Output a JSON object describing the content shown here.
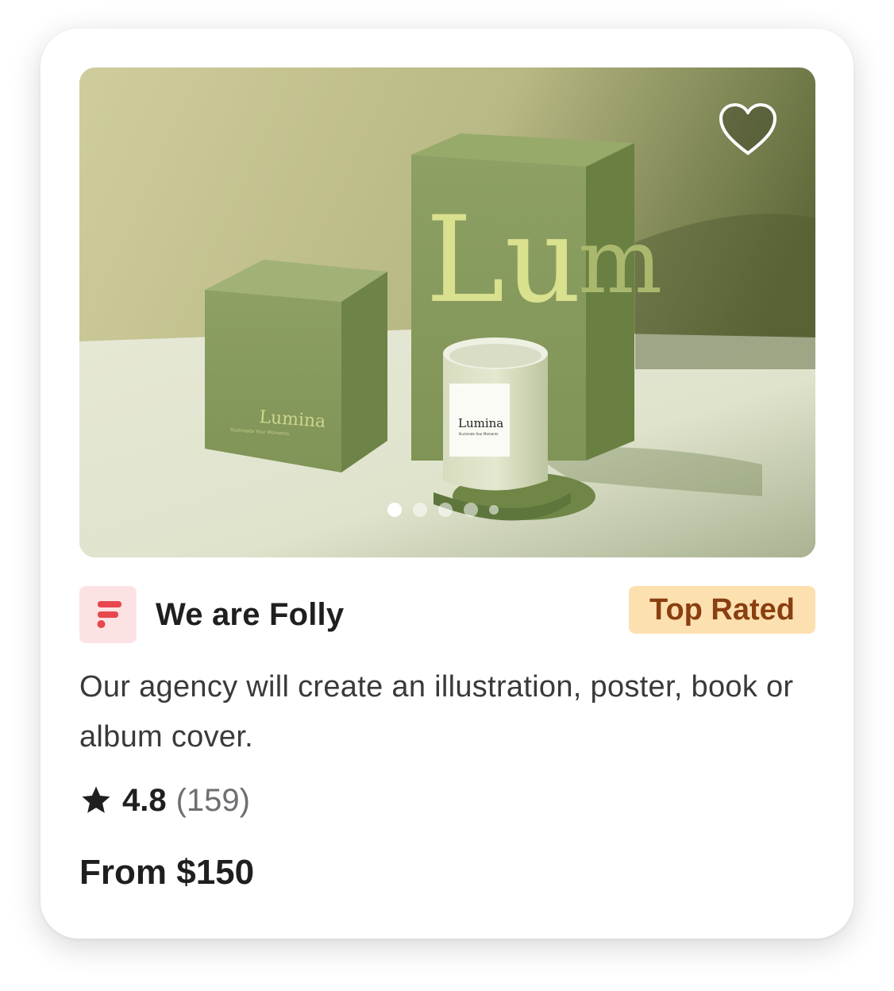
{
  "listing": {
    "image": {
      "alt_icon": "candle-product-photo",
      "box_small_brand": "Lumina",
      "box_small_tagline": "Illuminate Your Moments",
      "box_tall_brand": "Lum",
      "candle_brand": "Lumina",
      "candle_tagline": "Illuminate Your Moments",
      "slide_count": 5,
      "active_slide": 1
    },
    "favorite_icon": "heart-outline-icon",
    "seller": {
      "name": "We are Folly",
      "logo_icon": "folly-f-logo",
      "logo_bg": "#fde2e4",
      "logo_color": "#e8474f"
    },
    "badge": {
      "label": "Top Rated",
      "bg": "#fde0b0",
      "color": "#8a3f10"
    },
    "description": "Our agency will create an illustration, poster, book or album cover.",
    "rating": {
      "score": "4.8",
      "count": "(159)",
      "icon": "star-icon"
    },
    "price": "From $150"
  }
}
